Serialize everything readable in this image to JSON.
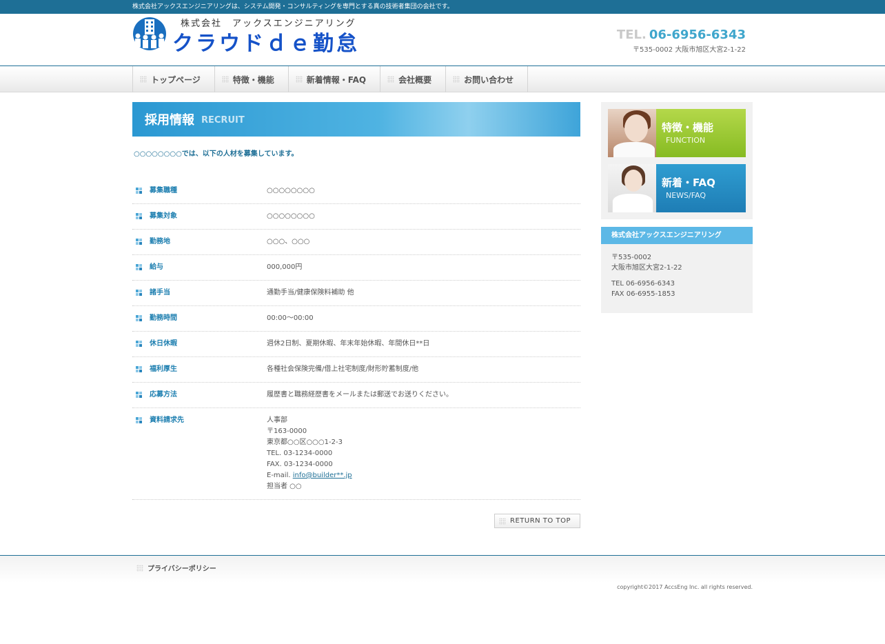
{
  "topbar": {
    "tagline": "株式会社アックスエンジニアリングは、システム開発・コンサルティングを専門とする真の技術者集団の会社です。"
  },
  "header": {
    "company_small": "株式会社　アックスエンジニアリング",
    "product_name": "クラウドｄｅ勤怠",
    "tel_prefix": "TEL.",
    "tel": "06-6956-6343",
    "address": "〒535-0002 大阪市旭区大宮2-1-22"
  },
  "nav": {
    "items": [
      {
        "label": "トップページ"
      },
      {
        "label": "特徴・機能"
      },
      {
        "label": "新着情報・FAQ"
      },
      {
        "label": "会社概要"
      },
      {
        "label": "お問い合わせ"
      }
    ]
  },
  "main": {
    "title_jp": "採用情報",
    "title_en": "RECRUIT",
    "lead": "○○○○○○○○では、以下の人材を募集しています。",
    "rows": [
      {
        "label": "募集職種",
        "lines": [
          "○○○○○○○○"
        ]
      },
      {
        "label": "募集対象",
        "lines": [
          "○○○○○○○○"
        ]
      },
      {
        "label": "勤務地",
        "lines": [
          "○○○、○○○"
        ]
      },
      {
        "label": "給与",
        "lines": [
          "000,000円"
        ]
      },
      {
        "label": "諸手当",
        "lines": [
          "通勤手当/健康保険料補助 他"
        ]
      },
      {
        "label": "勤務時間",
        "lines": [
          "00:00～00:00"
        ]
      },
      {
        "label": "休日休暇",
        "lines": [
          "週休2日制、夏期休暇、年末年始休暇、年間休日**日"
        ]
      },
      {
        "label": "福利厚生",
        "lines": [
          "各種社会保険完備/借上社宅制度/財形貯蓄制度/他"
        ]
      },
      {
        "label": "応募方法",
        "lines": [
          "履歴書と職務経歴書をメールまたは郵送でお送りください。"
        ]
      },
      {
        "label": "資料請求先",
        "lines": [
          "人事部",
          "〒163-0000",
          "東京都○○区○○○1-2-3",
          "TEL. 03-1234-0000",
          "FAX. 03-1234-0000"
        ],
        "email_prefix": "E-mail. ",
        "email": "info@builder**.jp",
        "last_line": "担当者 ○○"
      }
    ],
    "return_label": "RETURN TO TOP"
  },
  "sidebar": {
    "banner1": {
      "jp": "特徴・機能",
      "en": "FUNCTION"
    },
    "banner2": {
      "jp": "新着・FAQ",
      "en": "NEWS/FAQ"
    },
    "company": {
      "name": "株式会社アックスエンジニアリング",
      "postal": "〒535-0002",
      "address": "大阪市旭区大宮2-1-22",
      "tel": "TEL 06-6956-6343",
      "fax": "FAX 06-6955-1853"
    }
  },
  "footer": {
    "privacy": "プライバシーポリシー",
    "copyright": "copyright©2017 AccsEng Inc. all rights reserved."
  },
  "colors": {
    "brand": "#1e6f96",
    "accent": "#3fa6cc",
    "title_blue": "#2b98d2"
  }
}
